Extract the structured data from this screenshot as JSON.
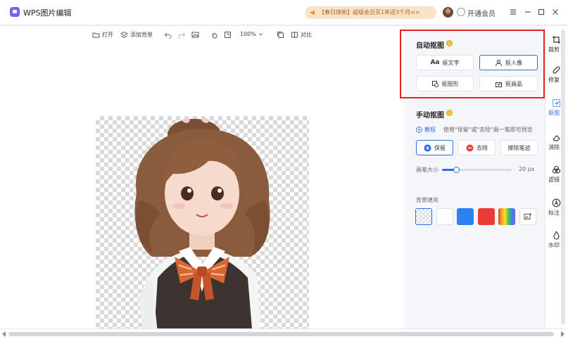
{
  "app": {
    "title": "WPS图片编辑"
  },
  "header": {
    "promo_text": "【春日焕新】超级会员买1年送3个月>>",
    "vip_label": "开通会员"
  },
  "toolbar": {
    "open_label": "打开",
    "add_bg_label": "添加背景",
    "zoom_label": "100%",
    "compare_label": "对比"
  },
  "panel": {
    "auto_cutout": {
      "title": "自动抠图",
      "buttons": [
        {
          "label": "抠文字"
        },
        {
          "label": "抠人像"
        },
        {
          "label": "抠图形"
        },
        {
          "label": "抠商品"
        }
      ]
    },
    "manual_cutout": {
      "title": "手动抠图",
      "tutorial_label": "教程",
      "hint": "使用\"保留\"或\"去除\"画一笔即可预览",
      "keep_label": "保留",
      "remove_label": "去除",
      "erase_label": "擦除笔迹",
      "brush_size_label": "画笔大小",
      "brush_size_value": "20 px",
      "brush_level": 0.2
    },
    "bg_fill": {
      "title": "背景填充",
      "swatch_colors": [
        "#ffffff",
        "#2b82f0",
        "#eb3b35"
      ]
    }
  },
  "rail": {
    "items": [
      {
        "label": "裁剪"
      },
      {
        "label": "修复"
      },
      {
        "label": "抠图"
      },
      {
        "label": "消除"
      },
      {
        "label": "滤镜"
      },
      {
        "label": "标注"
      },
      {
        "label": "水印"
      }
    ]
  },
  "colors": {
    "accent": "#2f6de1",
    "highlight_box": "#e8231f",
    "coin": "#f3c14b",
    "promo_bg": "#fbe3c7",
    "promo_text": "#b2641d"
  }
}
